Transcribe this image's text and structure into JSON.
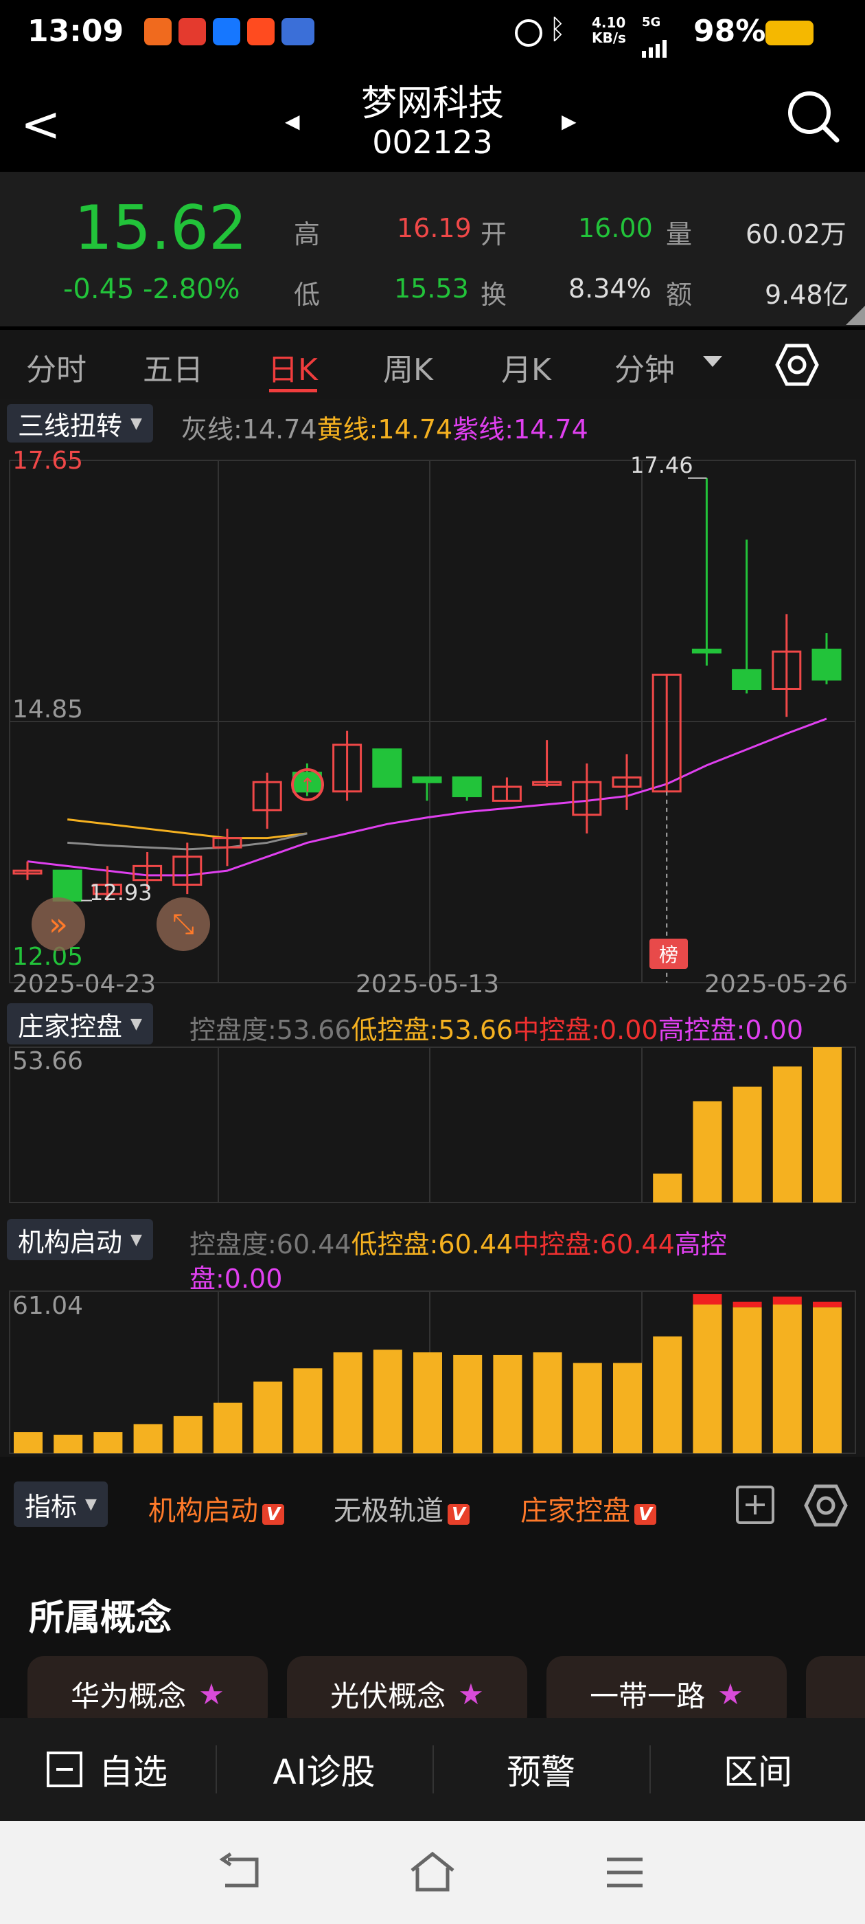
{
  "status": {
    "time": "13:09",
    "net_speed": "4.10\nKB/s",
    "signal": "5G",
    "battery": "98%",
    "app_icons": [
      "feishu",
      "di",
      "zhi",
      "tao",
      "vivo"
    ]
  },
  "nav": {
    "title": "梦网科技",
    "code": "002123",
    "back": "<",
    "prev": "◀",
    "next": "▶"
  },
  "quote": {
    "price": "15.62",
    "change": "-0.45",
    "change_pct": "-2.80%",
    "high_label": "高",
    "high": "16.19",
    "open_label": "开",
    "open": "16.00",
    "vol_label": "量",
    "vol": "60.02万",
    "low_label": "低",
    "low": "15.53",
    "turn_label": "换",
    "turn": "8.34%",
    "amt_label": "额",
    "amt": "9.48亿"
  },
  "tabs": [
    {
      "label": "分时"
    },
    {
      "label": "五日"
    },
    {
      "label": "日K"
    },
    {
      "label": "周K"
    },
    {
      "label": "月K"
    },
    {
      "label": "分钟"
    }
  ],
  "main_indicator": {
    "name": "三线扭转",
    "gray": "灰线:14.74",
    "yellow": "黄线:14.74",
    "purple": "紫线:14.74"
  },
  "kline": {
    "max_label": "17.65",
    "mid_label": "14.85",
    "min_label": "12.05",
    "peak_label": "17.46",
    "low_label": "12.93",
    "badge": "榜",
    "date_start": "2025-04-23",
    "date_mid": "2025-05-13",
    "date_end": "2025-05-26"
  },
  "ind1": {
    "name": "庄家控盘",
    "deg": "控盘度:53.66",
    "low": "低控盘:53.66",
    "mid": "中控盘:0.00",
    "high": "高控盘:0.00",
    "axis": "53.66"
  },
  "ind2": {
    "name": "机构启动",
    "deg": "控盘度:60.44",
    "low": "低控盘:60.44",
    "mid": "中控盘:60.44",
    "high_a": "高控",
    "high_b": "盘:0.00",
    "axis": "61.04"
  },
  "indicator_bar": {
    "label": "指标",
    "items": [
      "机构启动",
      "无极轨道",
      "庄家控盘"
    ],
    "badge": "V"
  },
  "concepts": {
    "title": "所属概念",
    "items": [
      "华为概念",
      "光伏概念",
      "一带一路"
    ]
  },
  "bottom_nav": {
    "watch": "自选",
    "ai": "AI诊股",
    "alert": "预警",
    "range": "区间"
  },
  "colors": {
    "up": "#f04848",
    "down": "#22c33a",
    "yellow": "#f5b120",
    "purple": "#e040f0",
    "gray": "#8a8a8a"
  },
  "chart_data": [
    {
      "type": "candlestick",
      "title": "日K",
      "candles": [
        {
          "o": 13.25,
          "c": 13.25,
          "h": 13.35,
          "l": 13.15,
          "up": true
        },
        {
          "o": 13.25,
          "c": 12.93,
          "h": 13.25,
          "l": 12.93,
          "up": false
        },
        {
          "o": 13.0,
          "c": 13.1,
          "h": 13.3,
          "l": 12.93,
          "up": true
        },
        {
          "o": 13.15,
          "c": 13.3,
          "h": 13.45,
          "l": 13.05,
          "up": true
        },
        {
          "o": 13.1,
          "c": 13.4,
          "h": 13.55,
          "l": 13.0,
          "up": true
        },
        {
          "o": 13.5,
          "c": 13.6,
          "h": 13.7,
          "l": 13.3,
          "up": true
        },
        {
          "o": 13.9,
          "c": 14.2,
          "h": 14.3,
          "l": 13.7,
          "up": true
        },
        {
          "o": 14.3,
          "c": 14.1,
          "h": 14.4,
          "l": 14.05,
          "up": false
        },
        {
          "o": 14.1,
          "c": 14.6,
          "h": 14.75,
          "l": 14.0,
          "up": true
        },
        {
          "o": 14.55,
          "c": 14.15,
          "h": 14.55,
          "l": 14.15,
          "up": false
        },
        {
          "o": 14.25,
          "c": 14.2,
          "h": 14.25,
          "l": 14.0,
          "up": false
        },
        {
          "o": 14.25,
          "c": 14.05,
          "h": 14.25,
          "l": 14.0,
          "up": false
        },
        {
          "o": 14.0,
          "c": 14.15,
          "h": 14.25,
          "l": 14.0,
          "up": true
        },
        {
          "o": 14.2,
          "c": 14.2,
          "h": 14.65,
          "l": 14.15,
          "up": true
        },
        {
          "o": 13.85,
          "c": 14.2,
          "h": 14.4,
          "l": 13.65,
          "up": true
        },
        {
          "o": 14.15,
          "c": 14.25,
          "h": 14.5,
          "l": 13.9,
          "up": true
        },
        {
          "o": 14.1,
          "c": 15.35,
          "h": 15.35,
          "l": 14.1,
          "up": true
        },
        {
          "o": 15.62,
          "c": 15.62,
          "h": 17.46,
          "l": 15.45,
          "up": false
        },
        {
          "o": 15.4,
          "c": 15.2,
          "h": 16.8,
          "l": 15.15,
          "up": false
        },
        {
          "o": 15.2,
          "c": 15.6,
          "h": 16.0,
          "l": 14.9,
          "up": true
        },
        {
          "o": 15.62,
          "c": 15.3,
          "h": 15.8,
          "l": 15.25,
          "up": false
        }
      ],
      "ylim": [
        12.05,
        17.65
      ],
      "series": [
        {
          "values": [
            13.85,
            13.8,
            13.75,
            13.7,
            13.65,
            13.6,
            13.6,
            13.65,
            13.7,
            13.8,
            13.85,
            13.9,
            13.95,
            14.0,
            14.05,
            14.1,
            14.2,
            14.4,
            14.55,
            14.7,
            14.85
          ]
        },
        {
          "values": [
            13.6,
            13.55,
            13.52,
            13.5,
            13.48,
            13.5,
            13.55,
            13.65,
            13.7,
            13.8,
            13.85,
            13.9,
            13.95,
            14.0,
            14.05,
            14.1,
            14.2,
            14.4,
            14.55,
            14.7,
            14.85
          ]
        },
        {
          "values": [
            13.35,
            13.3,
            13.25,
            13.2,
            13.2,
            13.25,
            13.4,
            13.55,
            13.65,
            13.75,
            13.82,
            13.88,
            13.92,
            13.96,
            14.0,
            14.05,
            14.18,
            14.38,
            14.55,
            14.72,
            14.88
          ]
        }
      ]
    },
    {
      "type": "bar",
      "title": "庄家控盘",
      "values": [
        0,
        0,
        0,
        0,
        0,
        0,
        0,
        0,
        0,
        0,
        0,
        0,
        0,
        0,
        0,
        0,
        10,
        35,
        40,
        47,
        53.66
      ],
      "ylim": [
        0,
        53.66
      ]
    },
    {
      "type": "bar",
      "title": "机构启动",
      "values": [
        8,
        7,
        8,
        11,
        14,
        19,
        27,
        32,
        38,
        39,
        38,
        37,
        37,
        38,
        34,
        34,
        44,
        56,
        55,
        56,
        55
      ],
      "red": [
        0,
        0,
        0,
        0,
        0,
        0,
        0,
        0,
        0,
        0,
        0,
        0,
        0,
        0,
        0,
        0,
        0,
        4,
        2,
        3,
        2
      ],
      "ylim": [
        0,
        61.04
      ]
    }
  ]
}
